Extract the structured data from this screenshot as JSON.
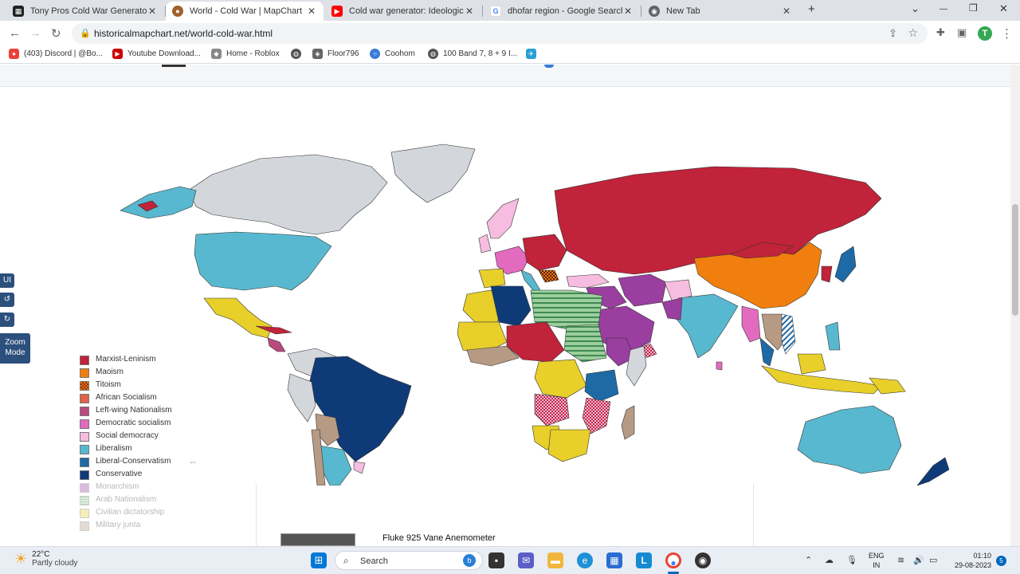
{
  "tabs": [
    {
      "title": "Tony Pros Cold War Generator --",
      "favicon": "checker-icon",
      "fav_color": "#202124"
    },
    {
      "title": "World - Cold War | MapChart",
      "favicon": "globe-icon",
      "fav_color": "#a0622d"
    },
    {
      "title": "Cold war generator: Ideological t",
      "favicon": "youtube-icon",
      "fav_color": "#ff0000"
    },
    {
      "title": "dhofar region - Google Search",
      "favicon": "google-icon",
      "fav_color": "#4285f4"
    },
    {
      "title": "New Tab",
      "favicon": "chrome-icon",
      "fav_color": "#5f6368"
    }
  ],
  "new_tab_label": "+",
  "window_controls": {
    "dropdown": "⌄",
    "minimize": "—",
    "restore": "❐",
    "close": "✕"
  },
  "toolbar": {
    "url": "historicalmapchart.net/world-cold-war.html",
    "avatar_letter": "T"
  },
  "bookmarks": [
    {
      "label": "(403) Discord | @Bo...",
      "icon": "discord-icon",
      "color": "#e8413a"
    },
    {
      "label": "Youtube Download...",
      "icon": "youtube-icon",
      "color": "#cc0000"
    },
    {
      "label": "Home - Roblox",
      "icon": "roblox-icon",
      "color": "#888888"
    },
    {
      "label": "",
      "icon": "globe-icon",
      "color": "#555555"
    },
    {
      "label": "Floor796",
      "icon": "floor-icon",
      "color": "#666666"
    },
    {
      "label": "Coohom",
      "icon": "coohom-icon",
      "color": "#3a7bd5"
    },
    {
      "label": "100 Band 7, 8 + 9 I...",
      "icon": "globe-icon",
      "color": "#555555"
    },
    {
      "label": "",
      "icon": "bird-icon",
      "color": "#2a9fd6"
    }
  ],
  "side_buttons": {
    "ui": "UI",
    "undo": "↺",
    "redo": "↻",
    "zoom_line1": "Zoom",
    "zoom_line2": "Mode"
  },
  "legend": [
    {
      "label": "Marxist-Leninism",
      "color": "#c0233a",
      "pattern": "solid",
      "faded": false
    },
    {
      "label": "Maoism",
      "color": "#f07f0f",
      "pattern": "solid",
      "faded": false
    },
    {
      "label": "Titoism",
      "color": "#8a2a10",
      "pattern": "checker",
      "faded": false
    },
    {
      "label": "African Socialism",
      "color": "#e0634a",
      "pattern": "solid",
      "faded": false
    },
    {
      "label": "Left-wing Nationalism",
      "color": "#b94a7e",
      "pattern": "solid",
      "faded": false
    },
    {
      "label": "Democratic socialism",
      "color": "#e26bc0",
      "pattern": "solid",
      "faded": false
    },
    {
      "label": "Social democracy",
      "color": "#f6bde0",
      "pattern": "solid",
      "faded": false
    },
    {
      "label": "Liberalism",
      "color": "#58b8cf",
      "pattern": "solid",
      "faded": false
    },
    {
      "label": "Liberal-Conservatism",
      "color": "#1e6aa6",
      "pattern": "solid",
      "faded": false
    },
    {
      "label": "Conservative",
      "color": "#0f3a78",
      "pattern": "solid",
      "faded": false
    },
    {
      "label": "Monarchism",
      "color": "#9a3ea0",
      "pattern": "solid",
      "faded": true
    },
    {
      "label": "Arab Nationalism",
      "color": "#9ccf9c",
      "pattern": "stripes",
      "faded": true
    },
    {
      "label": "Civilian dictatorship",
      "color": "#e8cf2a",
      "pattern": "solid",
      "faded": true
    },
    {
      "label": "Military junta",
      "color": "#b79a83",
      "pattern": "solid",
      "faded": true
    }
  ],
  "ad": {
    "title": "Fluke 925 Vane Anemometer"
  },
  "taskbar": {
    "weather_temp": "22°C",
    "weather_desc": "Partly cloudy",
    "search_label": "Search",
    "lang_line1": "ENG",
    "lang_line2": "IN",
    "time": "01:10",
    "date": "29-08-2023",
    "notif_count": "5"
  }
}
